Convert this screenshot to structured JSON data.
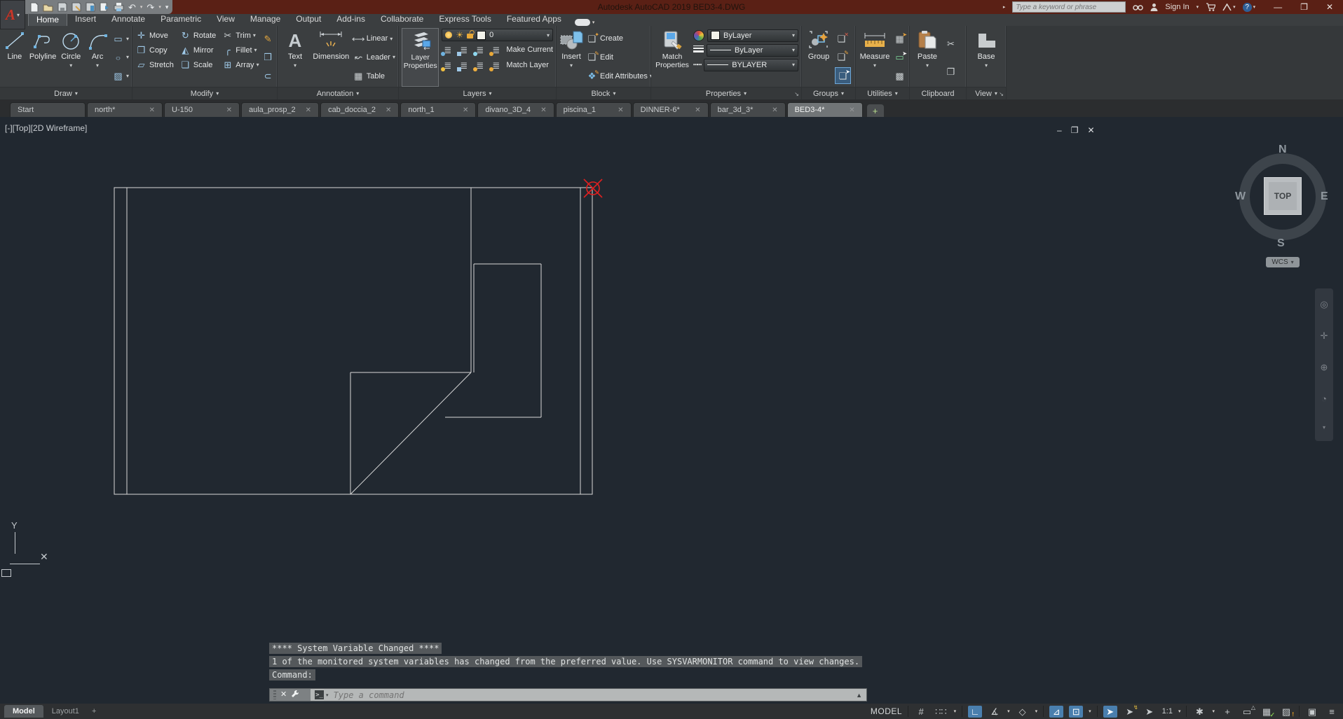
{
  "titlebar": {
    "title": "Autodesk AutoCAD 2019   BED3-4.DWG",
    "search_placeholder": "Type a keyword or phrase",
    "sign_in": "Sign In"
  },
  "ribbon": {
    "tabs": [
      "Home",
      "Insert",
      "Annotate",
      "Parametric",
      "View",
      "Manage",
      "Output",
      "Add-ins",
      "Collaborate",
      "Express Tools",
      "Featured Apps"
    ],
    "active_tab": "Home",
    "draw": {
      "label": "Draw",
      "line": "Line",
      "polyline": "Polyline",
      "circle": "Circle",
      "arc": "Arc"
    },
    "modify": {
      "label": "Modify",
      "move": "Move",
      "rotate": "Rotate",
      "trim": "Trim",
      "copy": "Copy",
      "mirror": "Mirror",
      "fillet": "Fillet",
      "stretch": "Stretch",
      "scale": "Scale",
      "array": "Array"
    },
    "annotation": {
      "label": "Annotation",
      "text": "Text",
      "dimension": "Dimension",
      "linear": "Linear",
      "leader": "Leader",
      "table": "Table"
    },
    "layers": {
      "label": "Layers",
      "layer_properties": "Layer Properties",
      "current_layer": "0",
      "make_current": "Make Current",
      "match_layer": "Match Layer"
    },
    "block": {
      "label": "Block",
      "insert": "Insert",
      "create": "Create",
      "edit": "Edit",
      "edit_attributes": "Edit Attributes"
    },
    "properties": {
      "label": "Properties",
      "match_properties": "Match Properties",
      "color": "ByLayer",
      "lineweight": "ByLayer",
      "linetype": "BYLAYER"
    },
    "groups": {
      "label": "Groups",
      "group": "Group"
    },
    "utilities": {
      "label": "Utilities",
      "measure": "Measure"
    },
    "clipboard": {
      "label": "Clipboard",
      "paste": "Paste"
    },
    "view": {
      "label": "View",
      "base": "Base"
    }
  },
  "file_tabs": [
    {
      "label": "Start",
      "closable": false,
      "active": false
    },
    {
      "label": "north*",
      "closable": true,
      "active": false
    },
    {
      "label": "U-150",
      "closable": true,
      "active": false
    },
    {
      "label": "aula_prosp_2",
      "closable": true,
      "active": false
    },
    {
      "label": "cab_doccia_2",
      "closable": true,
      "active": false
    },
    {
      "label": "north_1",
      "closable": true,
      "active": false
    },
    {
      "label": "divano_3D_4",
      "closable": true,
      "active": false
    },
    {
      "label": "piscina_1",
      "closable": true,
      "active": false
    },
    {
      "label": "DINNER-6*",
      "closable": true,
      "active": false
    },
    {
      "label": "bar_3d_3*",
      "closable": true,
      "active": false
    },
    {
      "label": "BED3-4*",
      "closable": true,
      "active": true
    }
  ],
  "viewport": {
    "label": "[-][Top][2D Wireframe]"
  },
  "viewcube": {
    "north": "N",
    "south": "S",
    "east": "E",
    "west": "W",
    "face": "TOP",
    "wcs": "WCS"
  },
  "ucs": {
    "y_label": "Y"
  },
  "command": {
    "history": [
      "**** System Variable Changed ****",
      "1 of the monitored system variables has changed from the preferred value. Use SYSVARMONITOR command to view changes.",
      "Command:"
    ],
    "prompt_placeholder": "Type a command"
  },
  "statusbar": {
    "model_tab": "Model",
    "layout_tab": "Layout1",
    "new_layout": "+",
    "space_label": "MODEL",
    "annotation_scale": "1:1"
  },
  "colors": {
    "titlebar": "#5a2015",
    "ribbon": "#3b3e40",
    "canvas_bg": "#212830",
    "wireframe_line": "#d9d9d9",
    "active_toggle_blue": "#4a7fae",
    "icon_blue": "#9fc9e8",
    "marker_red": "#e02020"
  }
}
